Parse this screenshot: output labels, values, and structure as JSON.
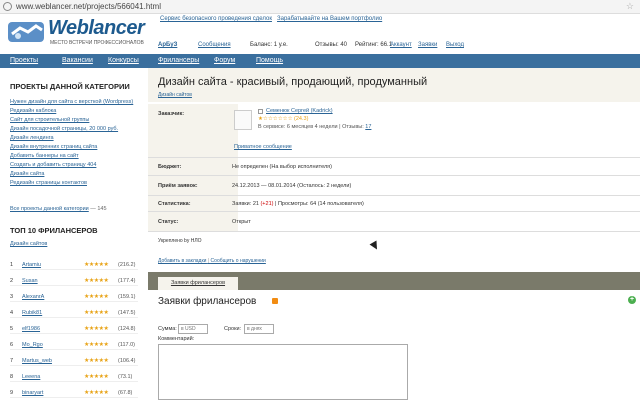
{
  "browser": {
    "url": "www.weblancer.net/projects/566041.html"
  },
  "header": {
    "logo_text": "Weblancer",
    "logo_tagline": "место встречи профессионалов",
    "top_link_1": "Сервис безопасного проведения сделок",
    "top_link_2": "Зарабатывайте на Вашем портфолио",
    "user": "АрБуЗ",
    "messages": "Сообщения",
    "balance": "Баланс: 1 у.е.",
    "bids": "Отзывы: 40",
    "rating": "Рейтинг: 66.1",
    "account": "Аккаунт",
    "requests": "Заявки",
    "logout": "Выход"
  },
  "nav": [
    "Проекты",
    "Вакансии",
    "Конкурсы",
    "Фрилансеры",
    "Форум",
    "Помощь"
  ],
  "sidebar": {
    "categories_title": "ПРОЕКТЫ ДАННОЙ КАТЕГОРИИ",
    "category_links": [
      "Нужен дизайн для сайта с версткой (Wordpress)",
      "Редизайн каблока",
      "Сайт для строительной группы",
      "Дизайн посадочной страницы, 20 000 руб.",
      "Дизайн лендинга",
      "Дизайн внутренних страниц сайта",
      "Добавить баннеры на сайт",
      "Создать и добавить страницу 404",
      "Дизайн сайта",
      "Редизайн страницы контактов"
    ],
    "all_projects": "Все проекты данной категории",
    "all_projects_count": "— 145",
    "top_title": "ТОП 10 ФРИЛАНСЕРОВ",
    "top_subtitle": "Дизайн сайтов",
    "freelancers": [
      {
        "n": "1",
        "name": "Artamiu",
        "stars": "★★★★★",
        "score": "(216.2)"
      },
      {
        "n": "2",
        "name": "Susan",
        "stars": "★★★★★",
        "score": "(177.4)"
      },
      {
        "n": "3",
        "name": "AlexanrA",
        "stars": "★★★★★",
        "score": "(159.1)"
      },
      {
        "n": "4",
        "name": "Rubik81",
        "stars": "★★★★★",
        "score": "(147.5)"
      },
      {
        "n": "5",
        "name": "elf1986",
        "stars": "★★★★★",
        "score": "(124.8)"
      },
      {
        "n": "6",
        "name": "Mo_Rgo",
        "stars": "★★★★★",
        "score": "(117.0)"
      },
      {
        "n": "7",
        "name": "Martus_web",
        "stars": "★★★★★",
        "score": "(106.4)"
      },
      {
        "n": "8",
        "name": "Leeena",
        "stars": "★★★★★",
        "score": "(73.1)"
      },
      {
        "n": "9",
        "name": "binaryart",
        "stars": "★★★★★",
        "score": "(67.8)"
      }
    ]
  },
  "project": {
    "title": "Дизайн сайта - красивый, продающий, продуманный",
    "category": "Дизайн сайтов",
    "customer_label": "Заказчик:",
    "customer_name": "Семенюк Сергей (Kadrick)",
    "customer_stars": "★☆☆☆☆☆☆ (24.3)",
    "customer_meta": "В сервисе: 6 месяцев 4 недели | Отзывы:",
    "customer_reviews": "17",
    "private_message": "Приватное сообщение",
    "budget_label": "Бюджет:",
    "budget_value": "Не определен (На выбор исполнителя)",
    "dates_label": "Приём заявок:",
    "dates_value": "24.12.2013 — 08.01.2014 (Осталось: 2 недели)",
    "stats_label": "Статистика:",
    "stats_requests": "Заявки: 21",
    "stats_new": "(+21)",
    "stats_views": "| Просмотры: 64 (14 пользователя)",
    "status_label": "Статус:",
    "status_value": "Открыт",
    "uploaded": "Укреплено by НЛО",
    "add_bookmark": "Добавить в закладки",
    "report": "Сообщить о нарушении"
  },
  "bids": {
    "tab": "Заявки фрилансеров",
    "title": "Заявки фрилансеров",
    "sum_label": "Сумма:",
    "sum_placeholder": "в USD",
    "term_label": "Сроки:",
    "term_placeholder": "в днях",
    "comment_label": "Комментарий:"
  },
  "colors": {
    "nav": "#3a6f9e",
    "panel": "#f5f3ec",
    "star": "#e8a317"
  }
}
